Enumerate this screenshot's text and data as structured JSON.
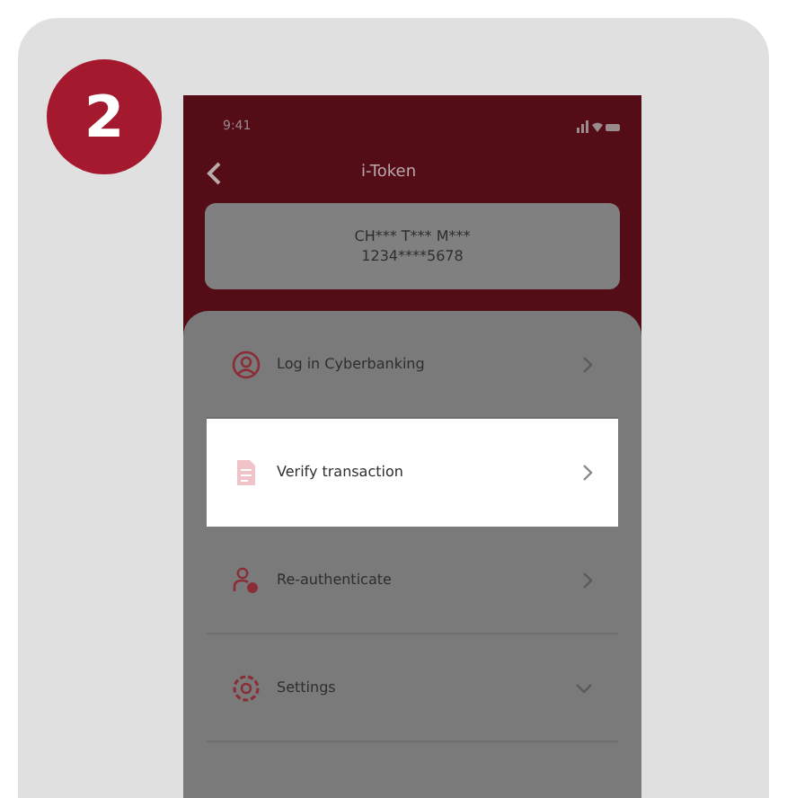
{
  "step_badge": "2",
  "phone": {
    "status_bar": {
      "time": "9:41"
    },
    "title": "i-Token",
    "account": {
      "name": "CH*** T*** M***",
      "number": "1234****5678"
    },
    "menu": [
      {
        "label": "Log in Cyberbanking",
        "kind": "chevron",
        "selected": false
      },
      {
        "label": "Verify transaction",
        "kind": "chevron",
        "selected": true
      },
      {
        "label": "Re-authenticate",
        "kind": "chevron",
        "selected": false
      },
      {
        "label": "Settings",
        "kind": "expand",
        "selected": false
      }
    ]
  }
}
